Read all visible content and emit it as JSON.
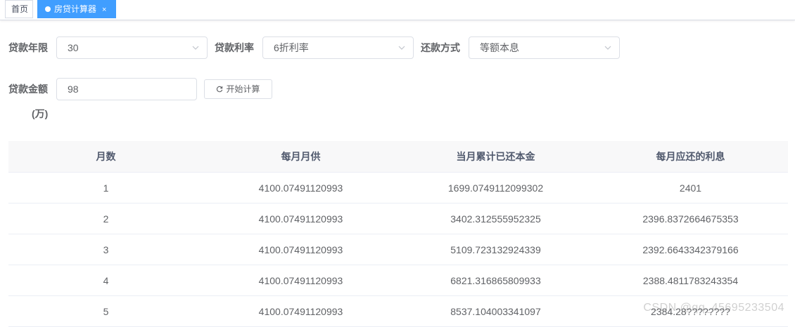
{
  "tabs": [
    {
      "label": "首页"
    },
    {
      "label": "房贷计算器",
      "close": "×"
    }
  ],
  "form": {
    "years_label": "贷款年限",
    "years_value": "30",
    "rate_label": "贷款利率",
    "rate_value": "6折利率",
    "method_label": "还款方式",
    "method_value": "等额本息",
    "amount_label": "贷款金额",
    "amount_unit": "(万)",
    "amount_value": "98",
    "calc_button": "开始计算"
  },
  "table": {
    "headers": [
      "月数",
      "每月月供",
      "当月累计已还本金",
      "每月应还的利息"
    ],
    "rows": [
      [
        "1",
        "4100.07491120993",
        "1699.0749112099302",
        "2401"
      ],
      [
        "2",
        "4100.07491120993",
        "3402.312555952325",
        "2396.8372664675353"
      ],
      [
        "3",
        "4100.07491120993",
        "5109.723132924339",
        "2392.6643342379166"
      ],
      [
        "4",
        "4100.07491120993",
        "6821.316865809933",
        "2388.4811783243354"
      ],
      [
        "5",
        "4100.07491120993",
        "8537.104003341097",
        "2384.28????????"
      ]
    ]
  },
  "watermark": "CSDN @qq_45695233504"
}
